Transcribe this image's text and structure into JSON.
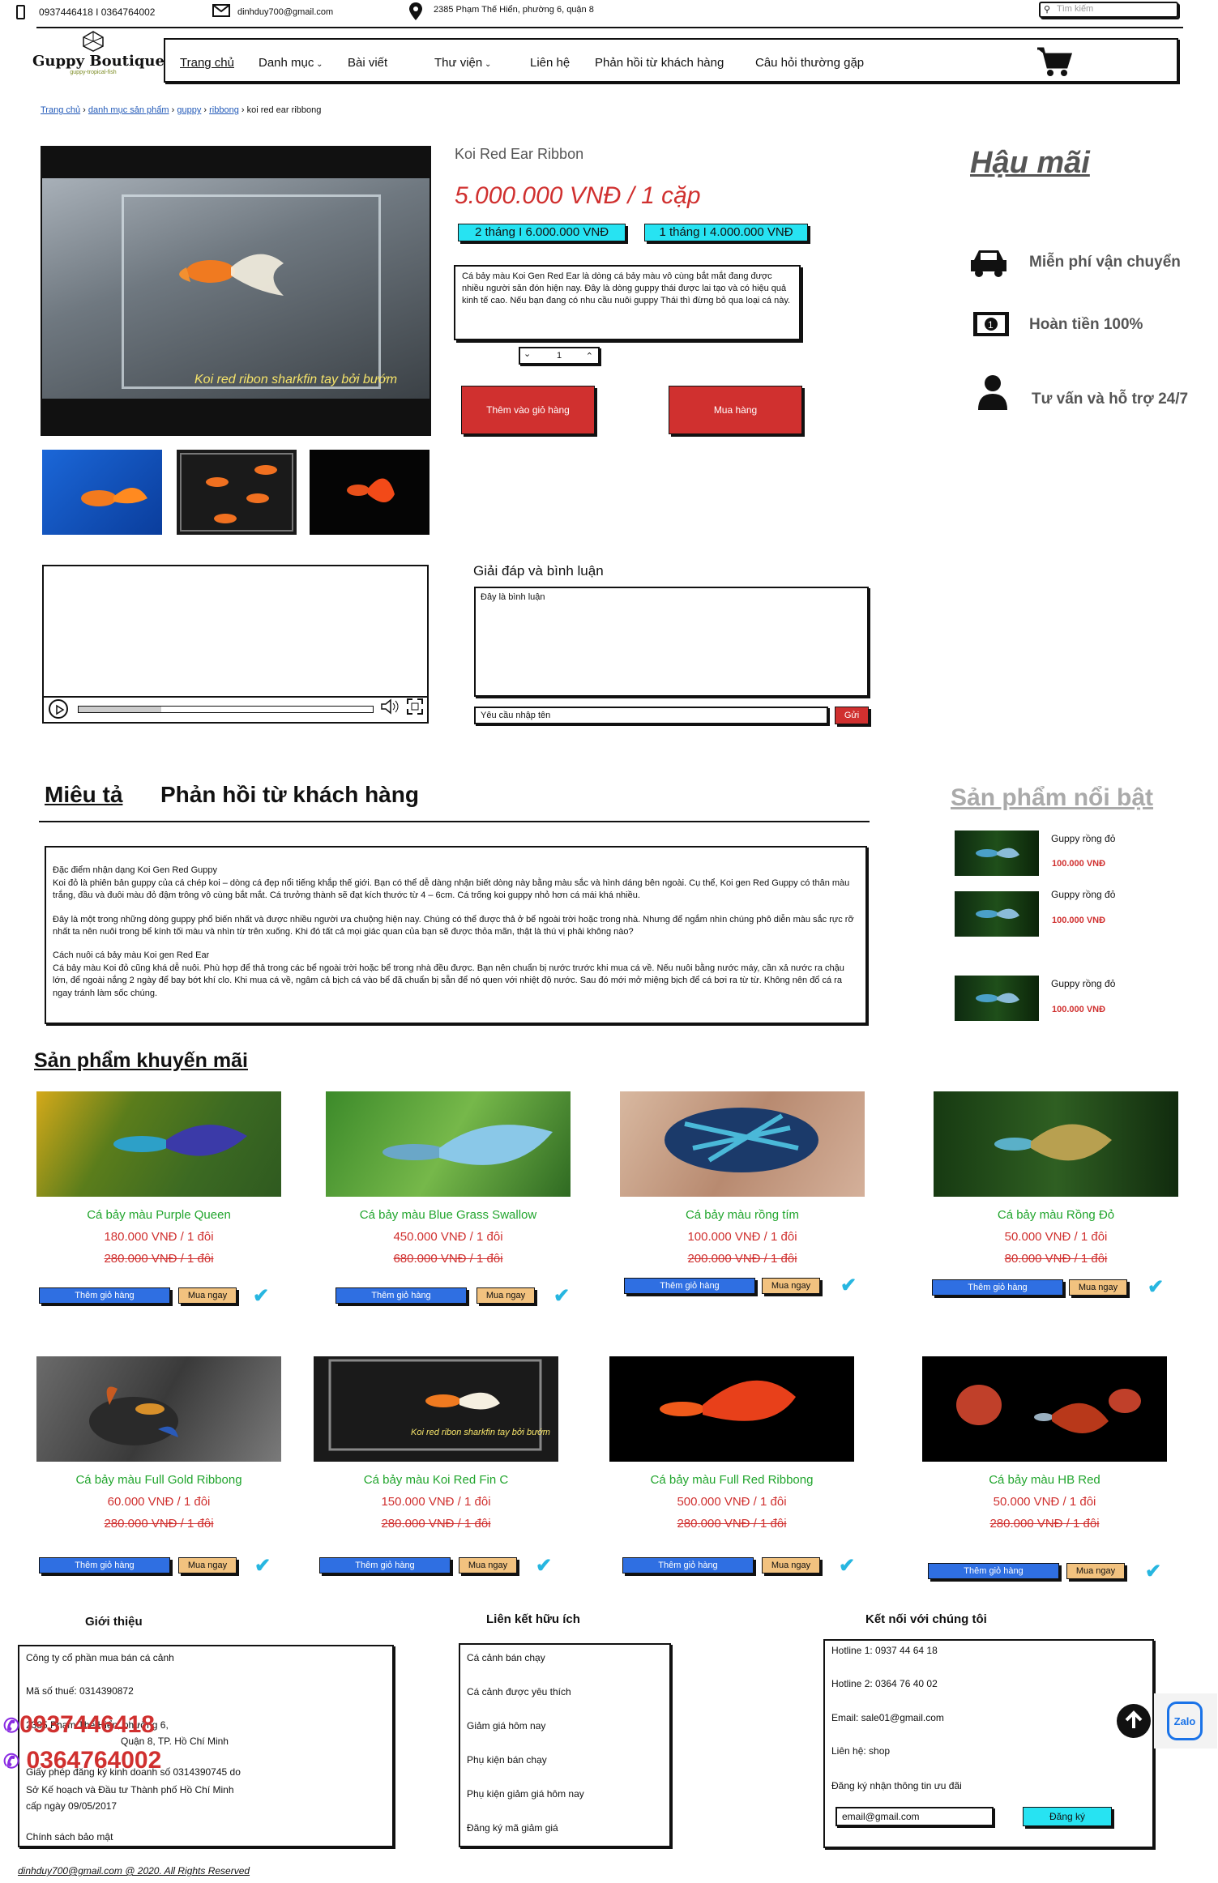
{
  "topbar": {
    "phones": "0937446418 I 0364764002",
    "email": "dinhduy700@gmail.com",
    "address": "2385 Phạm Thế Hiển, phường 6, quận 8",
    "search_placeholder": "Tìm kiếm"
  },
  "logo": {
    "name": "Guppy Boutique",
    "tagline": "guppy-tropical-fish"
  },
  "nav": [
    "Trang chủ",
    "Danh mục",
    "Bài viết",
    "Thư viện",
    "Liên hệ",
    "Phản hồi từ khách hàng",
    "Câu hỏi thường gặp"
  ],
  "breadcrumb": [
    "Trang chủ",
    "danh mục sản phẩm",
    "guppy",
    "ribbong",
    "koi red ear ribbong"
  ],
  "product": {
    "title": "Koi Red Ear Ribbon",
    "price": "5.000.000 VNĐ / 1 cặp",
    "option1": "2 tháng I 6.000.000 VNĐ",
    "option2": "1 tháng I 4.000.000 VNĐ",
    "summary": "Cá bảy màu Koi Gen Red Ear là dòng cá bảy màu vô cùng bắt mắt đang được nhiều người săn đón hiện nay. Đây là dòng guppy thái được lai tạo và có hiệu quả kinh tế cao. Nếu bạn đang có nhu cầu nuôi guppy Thái thì đừng bỏ qua loại cá này.",
    "qty": "1",
    "add_cart": "Thêm vào giỏ hàng",
    "buy": "Mua hàng",
    "image_caption": "Koi red ribon sharkfin tay bởi bướm"
  },
  "aftersales": {
    "title": "Hậu mãi",
    "items": [
      "Miễn phí vận chuyển",
      "Hoàn tiền 100%",
      "Tư vấn và hỗ trợ 24/7"
    ]
  },
  "comments": {
    "title": "Giải đáp và bình luận",
    "placeholder": "Đây là bình luận",
    "name_placeholder": "Yêu cầu nhập tên",
    "send": "Gửi"
  },
  "tabs": {
    "desc": "Miêu tả",
    "feedback": "Phản hồi từ khách hàng"
  },
  "description": [
    "Đặc điểm nhận dạng Koi Gen Red Guppy\nKoi đỏ là phiên bản guppy của cá chép koi – dòng cá đẹp nổi tiếng khắp thế giới. Bạn có thể dễ dàng nhận biết dòng này bằng màu sắc và hình dáng bên ngoài. Cụ thể, Koi gen Red Guppy có thân màu trắng, đầu và đuôi màu đỏ đậm trông vô cùng bắt mắt. Cá trưởng thành sẽ đạt kích thước từ 4 – 6cm. Cá trống koi guppy nhỏ hơn cá mái khá nhiều.",
    "Đây là một trong những dòng guppy phổ biến nhất và được nhiều người ưa chuộng hiện nay. Chúng có thể được thả ở bể ngoài trời hoặc trong nhà. Nhưng để ngắm nhìn chúng phô diễn màu sắc rực rỡ nhất ta nên nuôi trong bể kính tối màu và nhìn từ trên xuống. Khi đó tất cả mọi giác quan của bạn sẽ được thỏa mãn, thật là thú vị phải không nào?",
    "Cách nuôi cá bảy màu Koi gen Red Ear\nCá bảy màu Koi đỏ cũng khá dễ nuôi. Phù hợp để thả trong các bể ngoài trời hoặc bể trong nhà đều được. Bạn nên chuẩn bị nước trước khi mua cá về. Nếu nuôi bằng nước máy, cần xả nước ra chậu lớn, để ngoài nắng 2 ngày để bay bớt khí clo. Khi mua cá về, ngâm cả bịch cá vào bể đã chuẩn bị sẵn để nó quen với nhiệt độ nước. Sau đó mới mở miệng bịch để cá bơi ra từ từ. Không nên đổ cá ra ngay tránh làm sốc chúng."
  ],
  "featured": {
    "title": "Sản phẩm nổi bật",
    "items": [
      {
        "name": "Guppy rồng đỏ",
        "price": "100.000 VNĐ"
      },
      {
        "name": "Guppy rồng đỏ",
        "price": "100.000 VNĐ"
      },
      {
        "name": "Guppy rồng đỏ",
        "price": "100.000 VNĐ"
      }
    ]
  },
  "promo": {
    "title": "Sản phẩm khuyến mãi",
    "add": "Thêm giỏ hàng",
    "buy": "Mua ngay",
    "items": [
      {
        "name": "Cá bảy màu Purple Queen",
        "price": "180.000 VNĐ / 1 đôi",
        "old": "280.000 VNĐ / 1 đôi"
      },
      {
        "name": "Cá bảy màu Blue Grass Swallow",
        "price": "450.000 VNĐ / 1 đôi",
        "old": "680.000 VNĐ / 1 đôi"
      },
      {
        "name": "Cá bảy màu rồng tím",
        "price": "100.000 VNĐ / 1 đôi",
        "old": "200.000 VNĐ / 1 đôi"
      },
      {
        "name": "Cá bảy màu Rồng Đỏ",
        "price": "50.000 VNĐ / 1 đôi",
        "old": "80.000 VNĐ / 1 đôi"
      },
      {
        "name": "Cá bảy màu Full Gold Ribbong",
        "price": "60.000 VNĐ / 1 đôi",
        "old": "280.000 VNĐ / 1 đôi"
      },
      {
        "name": "Cá bảy màu Koi Red Fin C",
        "price": "150.000 VNĐ / 1 đôi",
        "old": "280.000 VNĐ / 1 đôi",
        "caption": "Koi red ribon sharkfin tay bởi bướm"
      },
      {
        "name": "Cá bảy màu Full Red Ribbong",
        "price": "500.000 VNĐ / 1 đôi",
        "old": "280.000 VNĐ / 1 đôi"
      },
      {
        "name": "Cá bảy màu HB Red",
        "price": "50.000 VNĐ / 1 đôi",
        "old": "280.000 VNĐ / 1 đôi"
      }
    ]
  },
  "footer": {
    "intro_title": "Giới thiệu",
    "intro": [
      "Công ty cổ phần mua bán cá cảnh",
      "Mã số thuế: 0314390872",
      "2385 Phạm Thế Hiển, phường 6,",
      "Quận 8, TP. Hồ Chí Minh",
      "Giấy phép đăng ký kinh doanh số 0314390745 do",
      "Sở Kế hoạch và Đầu tư Thành phố Hồ Chí Minh",
      "cấp ngày 09/05/2017",
      "Chính sách bảo mật"
    ],
    "links_title": "Liên kết hữu ích",
    "links": [
      "Cá cảnh bán chạy",
      "Cá cảnh được yêu thích",
      "Giảm giá hôm nay",
      "Phụ kiện bán chạy",
      "Phụ kiện giảm giá hôm nay",
      "Đăng ký mã giảm giá"
    ],
    "connect_title": "Kết nối với chúng tôi",
    "connect": [
      "Hotline 1: 0937 44 64 18",
      "Hotline 2: 0364 76 40 02",
      "Email: sale01@gmail.com",
      "Liên hệ: shop",
      "Đăng ký nhận thông tin ưu đãi"
    ],
    "email_value": "email@gmail.com",
    "subscribe": "Đăng ký",
    "phone1": "0937446418",
    "phone2": "0364764002",
    "zalo": "Zalo",
    "copyright": "dinhduy700@gmail.com @ 2020. All Rights Reserved"
  },
  "colors": {
    "accent_red": "#d0302f",
    "blue_button": "#2f6fe2",
    "cyan_button": "#27e3f2",
    "green_text": "#21a52d"
  }
}
